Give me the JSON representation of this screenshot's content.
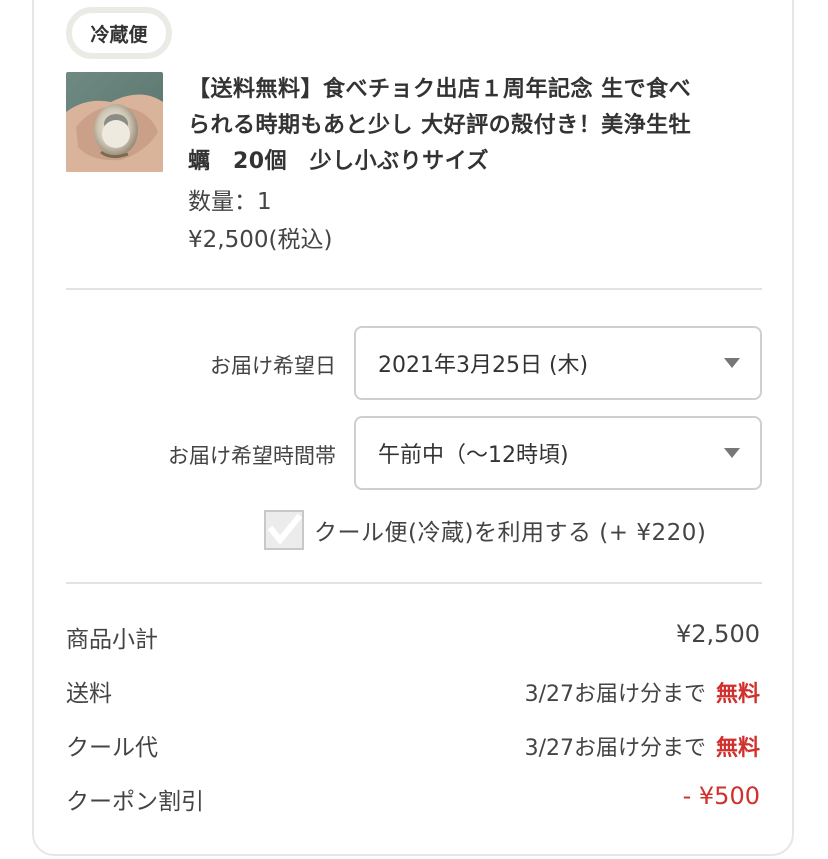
{
  "shipping_type_badge": "冷蔵便",
  "product": {
    "title_line1": "【送料無料】食べチョク出店１周年記念 生で食べ",
    "title_line2": "られる時期もあと少し 大好評の殻付き！美浄生牡",
    "title_line3": "蠣　20個　少し小ぶりサイズ",
    "quantity": "数量：1",
    "price": "¥2,500(税込)"
  },
  "delivery": {
    "date_label": "お届け希望日",
    "date_value": "2021年3月25日 (木)",
    "time_label": "お届け希望時間帯",
    "time_value": "午前中（〜12時頃)",
    "cool_option": "クール便(冷蔵)を利用する (+ ¥220)",
    "cool_checked": true
  },
  "summary": {
    "subtotal_label": "商品小計",
    "subtotal_value": "¥2,500",
    "shipping_label": "送料",
    "shipping_note": "3/27お届け分まで",
    "shipping_value": "無料",
    "cool_fee_label": "クール代",
    "cool_fee_note": "3/27お届け分まで",
    "cool_fee_value": "無料",
    "coupon_label": "クーポン割引",
    "coupon_value": "- ¥500"
  },
  "colors": {
    "accent_red": "#d0312d",
    "border": "#cfcfcf"
  }
}
